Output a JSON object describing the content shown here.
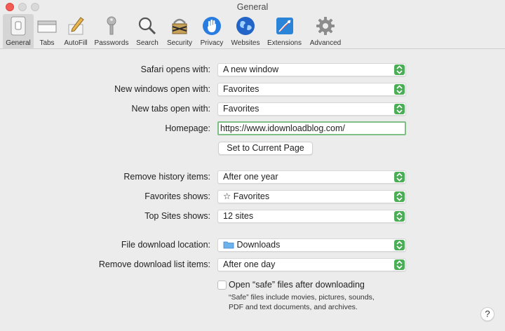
{
  "window": {
    "title": "General"
  },
  "toolbar": {
    "items": [
      {
        "label": "General",
        "icon": "general-switch-icon",
        "active": true
      },
      {
        "label": "Tabs",
        "icon": "tabs-icon"
      },
      {
        "label": "AutoFill",
        "icon": "autofill-pencil-icon"
      },
      {
        "label": "Passwords",
        "icon": "key-icon"
      },
      {
        "label": "Search",
        "icon": "magnifier-icon"
      },
      {
        "label": "Security",
        "icon": "security-icon"
      },
      {
        "label": "Privacy",
        "icon": "hand-icon"
      },
      {
        "label": "Websites",
        "icon": "globe-icon"
      },
      {
        "label": "Extensions",
        "icon": "extensions-icon"
      },
      {
        "label": "Advanced",
        "icon": "gear-icon"
      }
    ]
  },
  "settings": {
    "safari_opens_with": {
      "label": "Safari opens with:",
      "value": "A new window"
    },
    "new_windows_open_with": {
      "label": "New windows open with:",
      "value": "Favorites"
    },
    "new_tabs_open_with": {
      "label": "New tabs open with:",
      "value": "Favorites"
    },
    "homepage": {
      "label": "Homepage:",
      "value": "https://www.idownloadblog.com/"
    },
    "set_current_page_label": "Set to Current Page",
    "remove_history_items": {
      "label": "Remove history items:",
      "value": "After one year"
    },
    "favorites_shows": {
      "label": "Favorites shows:",
      "value": "Favorites"
    },
    "top_sites_shows": {
      "label": "Top Sites shows:",
      "value": "12 sites"
    },
    "file_download_location": {
      "label": "File download location:",
      "value": "Downloads"
    },
    "remove_download_list_items": {
      "label": "Remove download list items:",
      "value": "After one day"
    },
    "open_safe_files": {
      "label": "Open “safe” files after downloading",
      "checked": false
    },
    "safe_note": "“Safe” files include movies, pictures, sounds, PDF and text documents, and archives."
  },
  "help_label": "?",
  "colors": {
    "accent_green": "#4aae56",
    "focus_ring": "#7dbf85",
    "close_red": "#f35b55"
  }
}
